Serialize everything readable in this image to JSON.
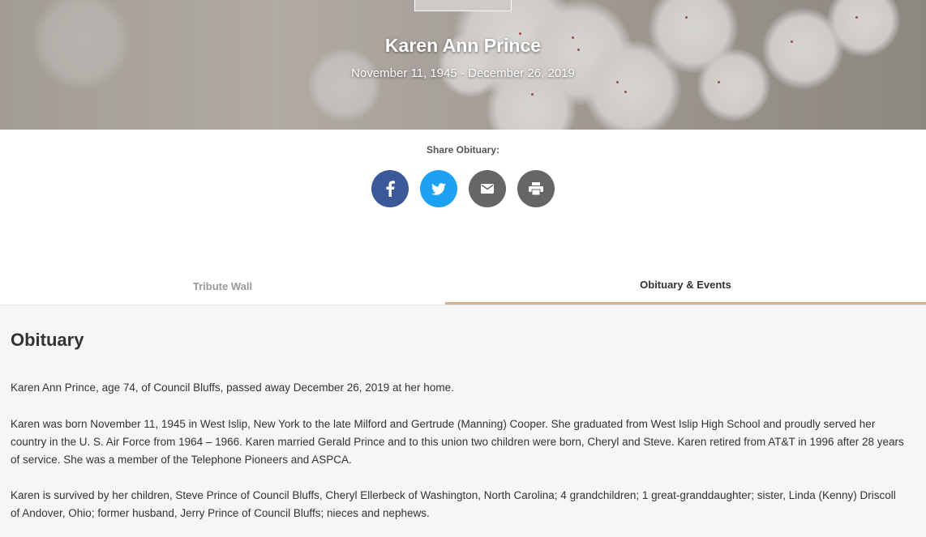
{
  "hero": {
    "name": "Karen Ann Prince",
    "dates": "November 11, 1945 - December 26, 2019"
  },
  "share": {
    "label": "Share Obituary:",
    "buttons": [
      {
        "icon": "facebook-icon",
        "color": "#3b5998"
      },
      {
        "icon": "twitter-icon",
        "color": "#1da1f2"
      },
      {
        "icon": "email-icon",
        "color": "#666666"
      },
      {
        "icon": "print-icon",
        "color": "#666666"
      }
    ]
  },
  "tabs": {
    "tribute_wall": "Tribute Wall",
    "obituary_events": "Obituary & Events",
    "active": "obituary_events",
    "accent_color": "#d2b48c"
  },
  "obituary": {
    "heading": "Obituary",
    "paragraphs": [
      "Karen Ann Prince, age 74, of Council Bluffs, passed away December 26, 2019 at her home.",
      "Karen was born November 11, 1945 in West Islip, New York to the late Milford and Gertrude (Manning) Cooper. She graduated from West Islip High School and proudly served her country in the U. S. Air Force from 1964 – 1966. Karen married Gerald Prince and to this union two children were born, Cheryl and Steve. Karen retired from AT&T in 1996 after 28 years of service. She was a member of the Telephone Pioneers and ASPCA.",
      "Karen is survived by her children, Steve Prince of Council Bluffs, Cheryl Ellerbeck of Washington, North Carolina; 4 grandchildren; 1 great-granddaughter; sister, Linda (Kenny) Driscoll of Andover, Ohio; former husband, Jerry Prince of Council Bluffs; nieces and nephews."
    ]
  }
}
